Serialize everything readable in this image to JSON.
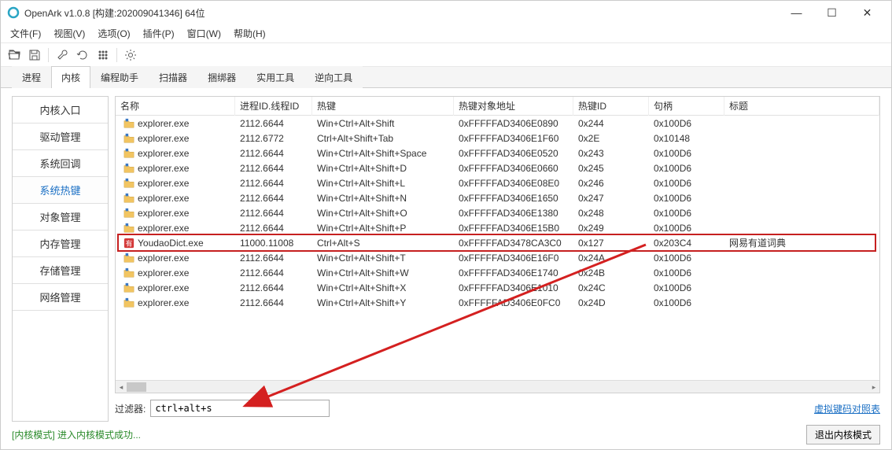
{
  "window": {
    "title": "OpenArk v1.0.8   [构建:202009041346]   64位"
  },
  "menu": {
    "items": [
      "文件(F)",
      "视图(V)",
      "选项(O)",
      "插件(P)",
      "窗口(W)",
      "帮助(H)"
    ]
  },
  "tabs": {
    "items": [
      "进程",
      "内核",
      "编程助手",
      "扫描器",
      "捆绑器",
      "实用工具",
      "逆向工具"
    ],
    "active": 1
  },
  "sidebar": {
    "items": [
      "内核入口",
      "驱动管理",
      "系统回调",
      "系统热键",
      "对象管理",
      "内存管理",
      "存储管理",
      "网络管理"
    ],
    "active": 3
  },
  "table": {
    "columns": [
      "名称",
      "进程ID.线程ID",
      "热键",
      "热键对象地址",
      "热键ID",
      "句柄",
      "标题"
    ],
    "rows": [
      {
        "icon": "explorer",
        "name": "explorer.exe",
        "pid": "2112.6644",
        "hotkey": "Win+Ctrl+Alt+Shift",
        "addr": "0xFFFFFAD3406E0890",
        "id": "0x244",
        "handle": "0x100D6",
        "title": ""
      },
      {
        "icon": "explorer",
        "name": "explorer.exe",
        "pid": "2112.6772",
        "hotkey": "Ctrl+Alt+Shift+Tab",
        "addr": "0xFFFFFAD3406E1F60",
        "id": "0x2E",
        "handle": "0x10148",
        "title": ""
      },
      {
        "icon": "explorer",
        "name": "explorer.exe",
        "pid": "2112.6644",
        "hotkey": "Win+Ctrl+Alt+Shift+Space",
        "addr": "0xFFFFFAD3406E0520",
        "id": "0x243",
        "handle": "0x100D6",
        "title": ""
      },
      {
        "icon": "explorer",
        "name": "explorer.exe",
        "pid": "2112.6644",
        "hotkey": "Win+Ctrl+Alt+Shift+D",
        "addr": "0xFFFFFAD3406E0660",
        "id": "0x245",
        "handle": "0x100D6",
        "title": ""
      },
      {
        "icon": "explorer",
        "name": "explorer.exe",
        "pid": "2112.6644",
        "hotkey": "Win+Ctrl+Alt+Shift+L",
        "addr": "0xFFFFFAD3406E08E0",
        "id": "0x246",
        "handle": "0x100D6",
        "title": ""
      },
      {
        "icon": "explorer",
        "name": "explorer.exe",
        "pid": "2112.6644",
        "hotkey": "Win+Ctrl+Alt+Shift+N",
        "addr": "0xFFFFFAD3406E1650",
        "id": "0x247",
        "handle": "0x100D6",
        "title": ""
      },
      {
        "icon": "explorer",
        "name": "explorer.exe",
        "pid": "2112.6644",
        "hotkey": "Win+Ctrl+Alt+Shift+O",
        "addr": "0xFFFFFAD3406E1380",
        "id": "0x248",
        "handle": "0x100D6",
        "title": ""
      },
      {
        "icon": "explorer",
        "name": "explorer.exe",
        "pid": "2112.6644",
        "hotkey": "Win+Ctrl+Alt+Shift+P",
        "addr": "0xFFFFFAD3406E15B0",
        "id": "0x249",
        "handle": "0x100D6",
        "title": ""
      },
      {
        "icon": "youdao",
        "name": "YoudaoDict.exe",
        "pid": "11000.11008",
        "hotkey": "Ctrl+Alt+S",
        "addr": "0xFFFFFAD3478CA3C0",
        "id": "0x127",
        "handle": "0x203C4",
        "title": "网易有道词典"
      },
      {
        "icon": "explorer",
        "name": "explorer.exe",
        "pid": "2112.6644",
        "hotkey": "Win+Ctrl+Alt+Shift+T",
        "addr": "0xFFFFFAD3406E16F0",
        "id": "0x24A",
        "handle": "0x100D6",
        "title": ""
      },
      {
        "icon": "explorer",
        "name": "explorer.exe",
        "pid": "2112.6644",
        "hotkey": "Win+Ctrl+Alt+Shift+W",
        "addr": "0xFFFFFAD3406E1740",
        "id": "0x24B",
        "handle": "0x100D6",
        "title": ""
      },
      {
        "icon": "explorer",
        "name": "explorer.exe",
        "pid": "2112.6644",
        "hotkey": "Win+Ctrl+Alt+Shift+X",
        "addr": "0xFFFFFAD3406E1010",
        "id": "0x24C",
        "handle": "0x100D6",
        "title": ""
      },
      {
        "icon": "explorer",
        "name": "explorer.exe",
        "pid": "2112.6644",
        "hotkey": "Win+Ctrl+Alt+Shift+Y",
        "addr": "0xFFFFFAD3406E0FC0",
        "id": "0x24D",
        "handle": "0x100D6",
        "title": ""
      }
    ],
    "highlighted_index": 8
  },
  "filter": {
    "label": "过滤器:",
    "value": "ctrl+alt+s",
    "link": "虚拟键码对照表"
  },
  "status": {
    "text": "[内核模式] 进入内核模式成功...",
    "exit_button": "退出内核模式"
  }
}
